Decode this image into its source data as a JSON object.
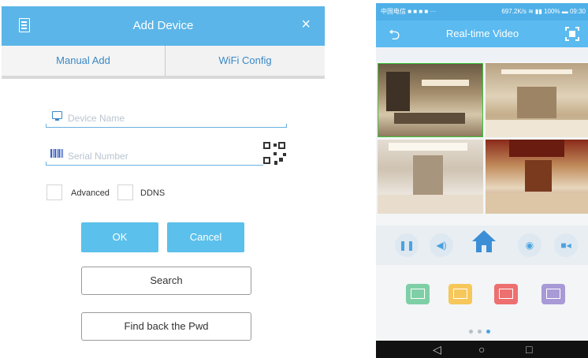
{
  "add_device": {
    "title": "Add Device",
    "close_glyph": "×",
    "tabs": [
      {
        "label": "Manual Add"
      },
      {
        "label": "WiFi Config"
      }
    ],
    "device_name_placeholder": "Device Name",
    "serial_number_placeholder": "Serial Number",
    "advanced_label": "Advanced",
    "ddns_label": "DDNS",
    "ok_label": "OK",
    "cancel_label": "Cancel",
    "search_label": "Search",
    "find_pwd_label": "Find back the Pwd",
    "icons": [
      "document-icon",
      "close-icon",
      "monitor-icon",
      "barcode-icon",
      "qr-code-icon"
    ]
  },
  "realtime_video": {
    "status_left": "中国电信 ■ ■ ■ ■ ···",
    "status_right": "697.2K/s ≋ ▮▮ 100% ▬ 09:30",
    "title": "Real-time Video",
    "back_glyph": "⮌",
    "controls": [
      {
        "name": "pause",
        "glyph": "❚❚"
      },
      {
        "name": "volume",
        "glyph": "◀)"
      },
      {
        "name": "home",
        "glyph": ""
      },
      {
        "name": "snapshot",
        "glyph": "◉"
      },
      {
        "name": "record",
        "glyph": "■◂"
      }
    ],
    "layouts": [
      {
        "name": "single",
        "color": "#7fcfa6"
      },
      {
        "name": "quad",
        "color": "#f6c75a"
      },
      {
        "name": "nine",
        "color": "#ee6f6f"
      },
      {
        "name": "sixteen",
        "color": "#a79ad6"
      }
    ],
    "nav": {
      "back": "◁",
      "home": "○",
      "recent": "□"
    },
    "colors": {
      "header": "#5bbaef",
      "selected_border": "#3cc23c"
    }
  }
}
